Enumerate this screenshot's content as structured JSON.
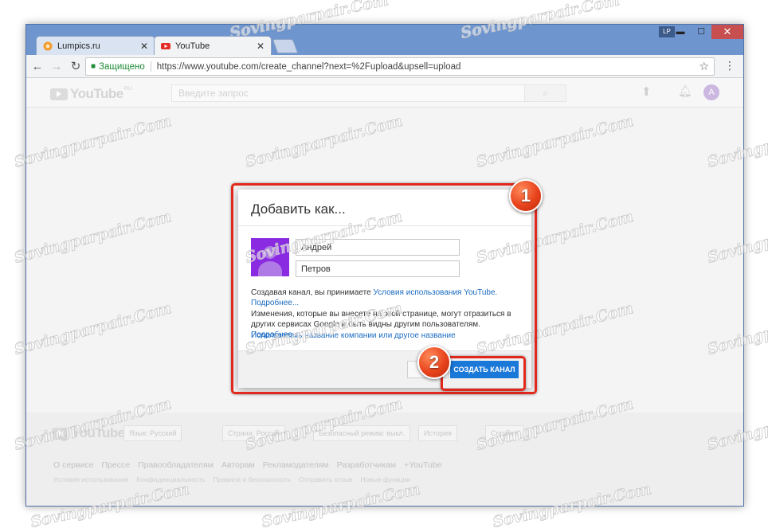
{
  "browser": {
    "tabs": [
      {
        "label": "Lumpics.ru",
        "icon": "orange-favicon-icon",
        "active": false
      },
      {
        "label": "YouTube",
        "icon": "youtube-favicon-icon",
        "active": true
      }
    ],
    "profile_badge": "LP",
    "window_controls": {
      "minimize": "▬",
      "maximize": "☐",
      "close": "✕"
    },
    "tab_close": "✕",
    "address": {
      "secure_label": "Защищено",
      "url": "https://www.youtube.com/create_channel?next=%2Fupload&upsell=upload"
    }
  },
  "youtube": {
    "logo_text": "YouTube",
    "logo_region": "RU",
    "search_placeholder": "Введите запрос",
    "avatar_letter": "A"
  },
  "dialog": {
    "title": "Добавить как...",
    "first_name": "Андрей",
    "last_name": "Петров",
    "terms_prefix": "Создавая канал, вы принимаете ",
    "terms_link": "Условия использования YouTube.",
    "more_link_1": "Подробнее...",
    "changes_text": "Изменения, которые вы внесете на этой странице, могут отразиться в других сервисах Google и быть видны другим пользователям. ",
    "more_link_2": "Подробнее...",
    "use_company_link": "Использовать название компании или другое название",
    "cancel_label": "ОТ",
    "create_label": "СОЗДАТЬ КАНАЛ"
  },
  "markers": {
    "step1": "1",
    "step2": "2"
  },
  "highlight_color": "#e2281c",
  "footer": {
    "logo_text": "YouTube",
    "language_btn": "Язык: Русский",
    "country_btn": "Страна: Россия",
    "safe_btn": "Безопасный режим: выкл.",
    "history_btn": "История",
    "help_btn": "Справка",
    "links": [
      "О сервисе",
      "Прессе",
      "Правообладателям",
      "Авторам",
      "Рекламодателям",
      "Разработчикам",
      "+YouTube"
    ],
    "links2": [
      "Условия использования",
      "Конфиденциальность",
      "Правила и безопасность",
      "Отправить отзыв",
      "Новые функции"
    ]
  },
  "watermark": "Sovingparpair.Com"
}
